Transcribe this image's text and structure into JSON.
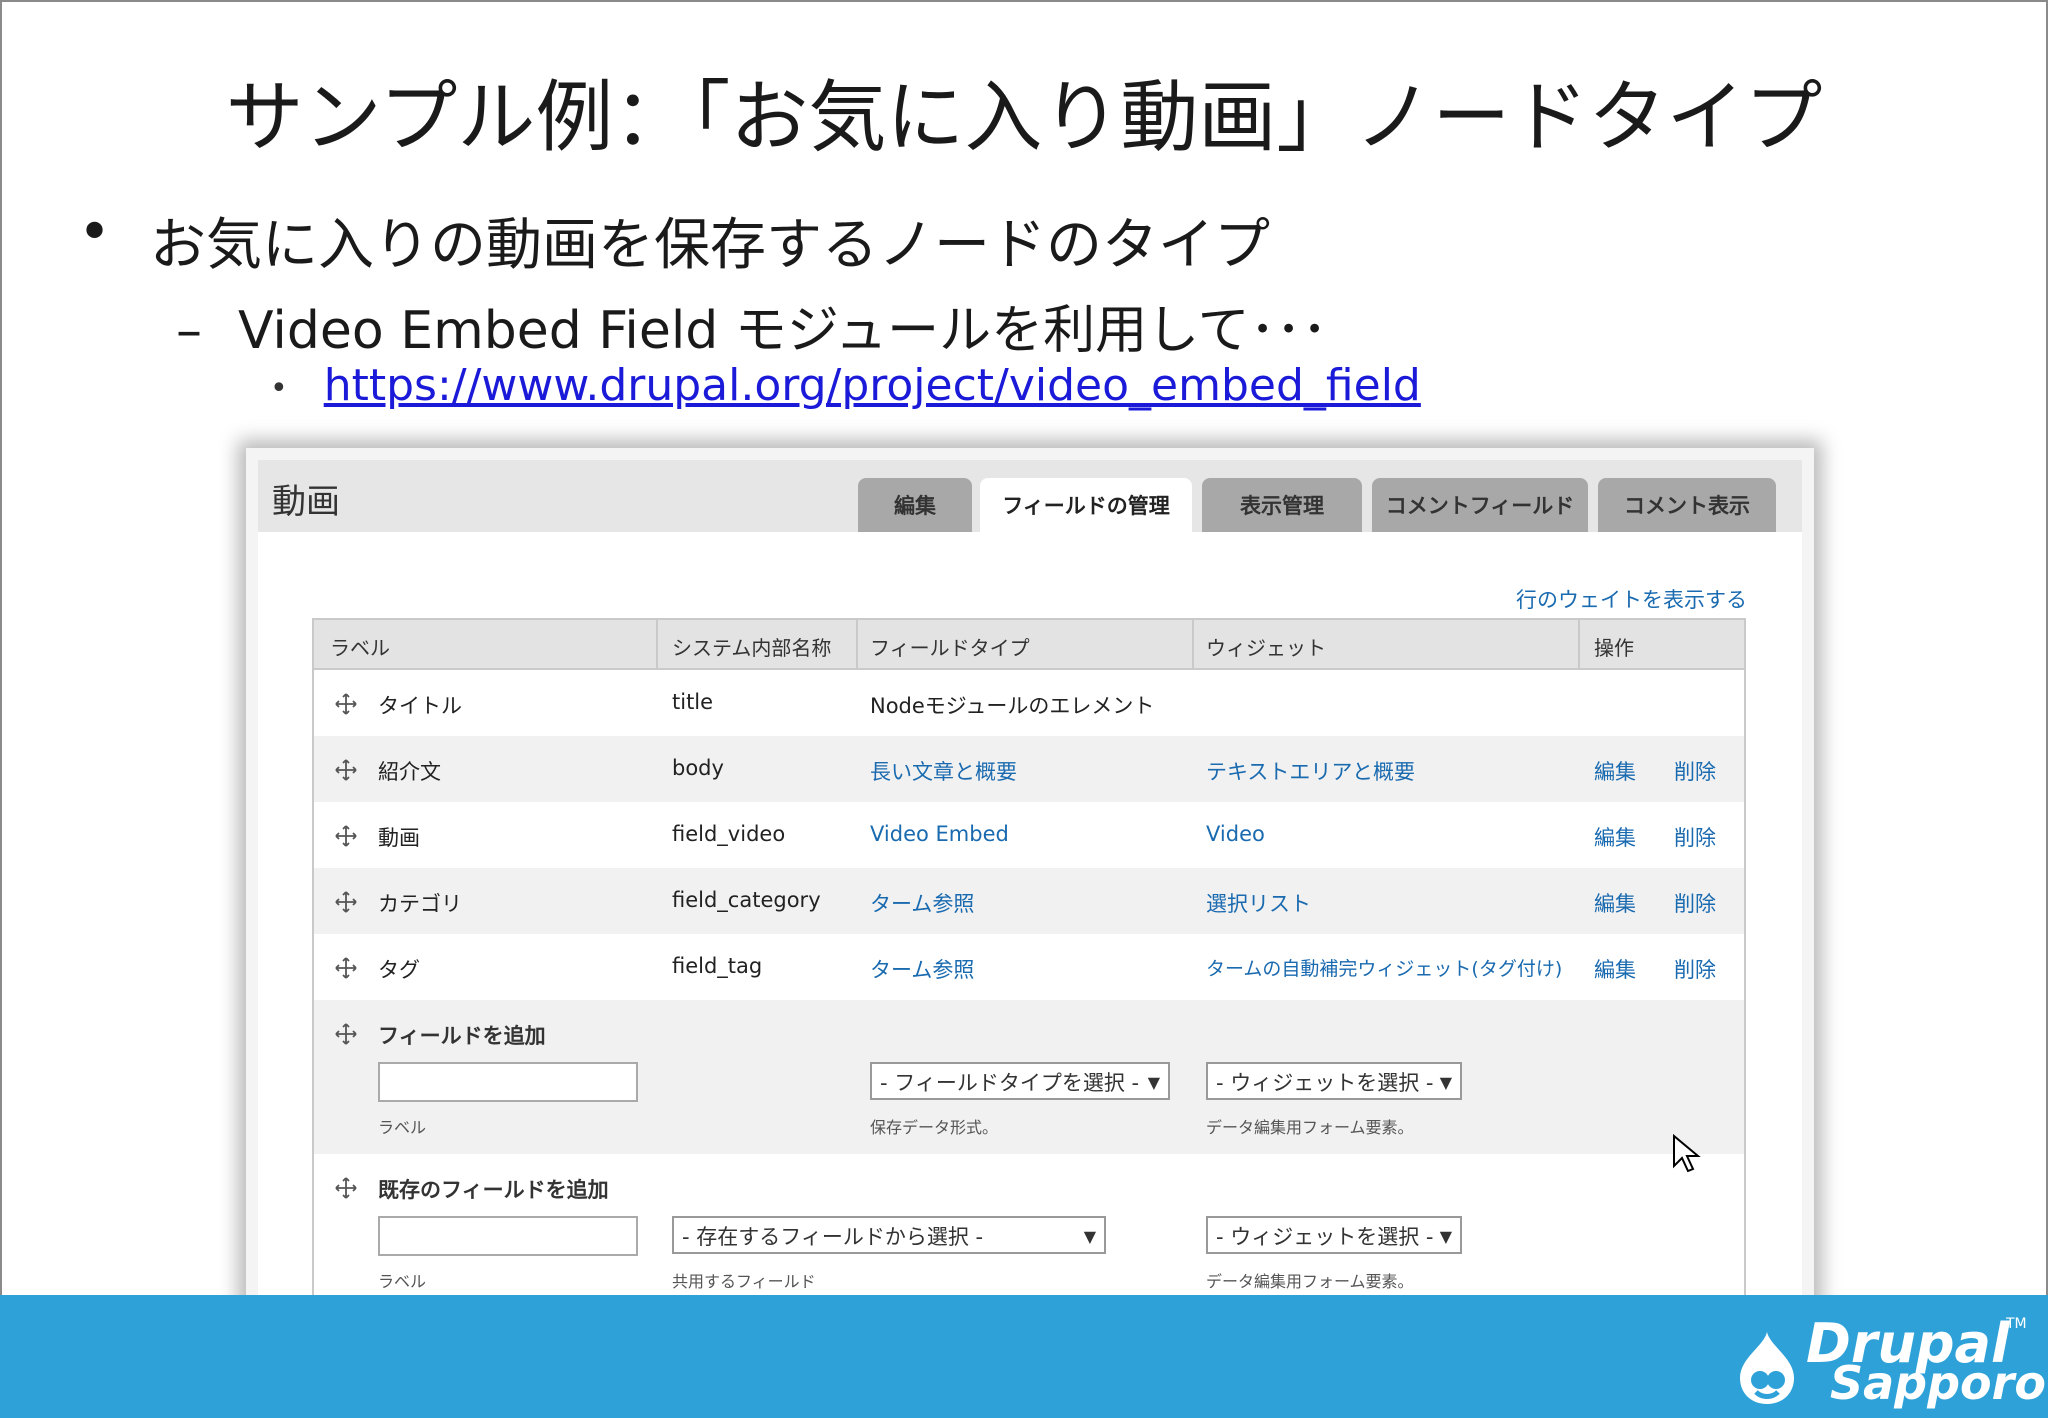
{
  "slide": {
    "title": "サンプル例：「お気に入り動画」ノードタイプ",
    "bullet1": "お気に入りの動画を保存するノードのタイプ",
    "bullet2_dash": "–",
    "bullet2": "Video Embed Field モジュールを利用して･･･",
    "bullet3_link": "https://www.drupal.org/project/video_embed_field",
    "bullet_dot": "•"
  },
  "logo": {
    "line1": "Drupal",
    "line2": "Sapporo",
    "tm": "TM"
  },
  "page": {
    "title": "動画",
    "weight_link": "行のウェイトを表示する"
  },
  "tabs": [
    {
      "label": "編集"
    },
    {
      "label": "フィールドの管理"
    },
    {
      "label": "表示管理"
    },
    {
      "label": "コメントフィールド"
    },
    {
      "label": "コメント表示"
    }
  ],
  "table": {
    "headers": [
      "ラベル",
      "システム内部名称",
      "フィールドタイプ",
      "ウィジェット",
      "操作"
    ],
    "rows": [
      {
        "label": "タイトル",
        "machine": "title",
        "type": "Nodeモジュールのエレメント",
        "widget": "",
        "edit": "",
        "delete": ""
      },
      {
        "label": "紹介文",
        "machine": "body",
        "type": "長い文章と概要",
        "widget": "テキストエリアと概要",
        "edit": "編集",
        "delete": "削除"
      },
      {
        "label": "動画",
        "machine": "field_video",
        "type": "Video Embed",
        "widget": "Video",
        "edit": "編集",
        "delete": "削除"
      },
      {
        "label": "カテゴリ",
        "machine": "field_category",
        "type": "ターム参照",
        "widget": "選択リスト",
        "edit": "編集",
        "delete": "削除"
      },
      {
        "label": "タグ",
        "machine": "field_tag",
        "type": "ターム参照",
        "widget": "タームの自動補完ウィジェット(タグ付け)",
        "edit": "編集",
        "delete": "削除"
      }
    ]
  },
  "add_field": {
    "title": "フィールドを追加",
    "label_hint": "ラベル",
    "type_select": "- フィールドタイプを選択 -",
    "type_hint": "保存データ形式。",
    "widget_select": "- ウィジェットを選択 -",
    "widget_hint": "データ編集用フォーム要素。"
  },
  "existing_field": {
    "title": "既存のフィールドを追加",
    "label_hint": "ラベル",
    "field_select": "- 存在するフィールドから選択 -",
    "field_hint": "共用するフィールド",
    "widget_select": "- ウィジェットを選択 -",
    "widget_hint": "データ編集用フォーム要素。"
  },
  "colors": {
    "link": "#1a6ab0",
    "footer": "#2ea2d8",
    "url": "#1a1ad8"
  }
}
